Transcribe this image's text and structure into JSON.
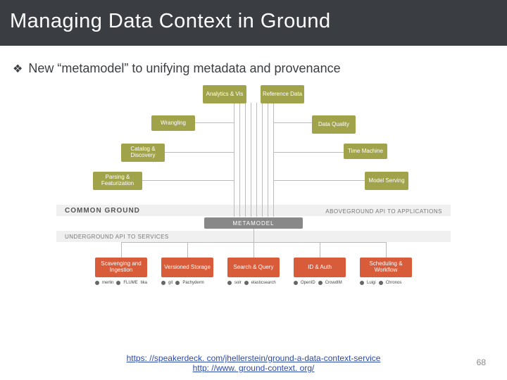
{
  "title": "Managing Data Context in Ground",
  "bullet": "New “metamodel” to unifying metadata and provenance",
  "diagram": {
    "green_boxes": {
      "analytics": "Analytics & Vis",
      "reference": "Reference Data",
      "wrangling": "Wrangling",
      "quality": "Data Quality",
      "catalog": "Catalog & Discovery",
      "time": "Time Machine",
      "parsing": "Parsing & Featurization",
      "serving": "Model Serving"
    },
    "common": "COMMON GROUND",
    "api_above": "ABOVEGROUND API TO APPLICATIONS",
    "api_below": "UNDERGROUND API TO SERVICES",
    "metamodel": "METAMODEL",
    "red_boxes": {
      "scavenging": "Scavenging and Ingestion",
      "versioned": "Versioned Storage",
      "search": "Search & Query",
      "id": "ID & Auth",
      "scheduling": "Scheduling & Workflow"
    },
    "logos": {
      "row1": [
        "merlin",
        "FLUME",
        "tika"
      ],
      "row2": [
        "git",
        "Pachyderm"
      ],
      "row3": [
        "solr",
        "elasticsearch"
      ],
      "row4": [
        "OpenID",
        "CrowdIM"
      ],
      "row5": [
        "Luigi",
        "Chronos"
      ]
    }
  },
  "links": {
    "l1": "https: //speakerdeck. com/jhellerstein/ground-a-data-context-service",
    "l2": "http: //www. ground-context. org/"
  },
  "page": "68"
}
